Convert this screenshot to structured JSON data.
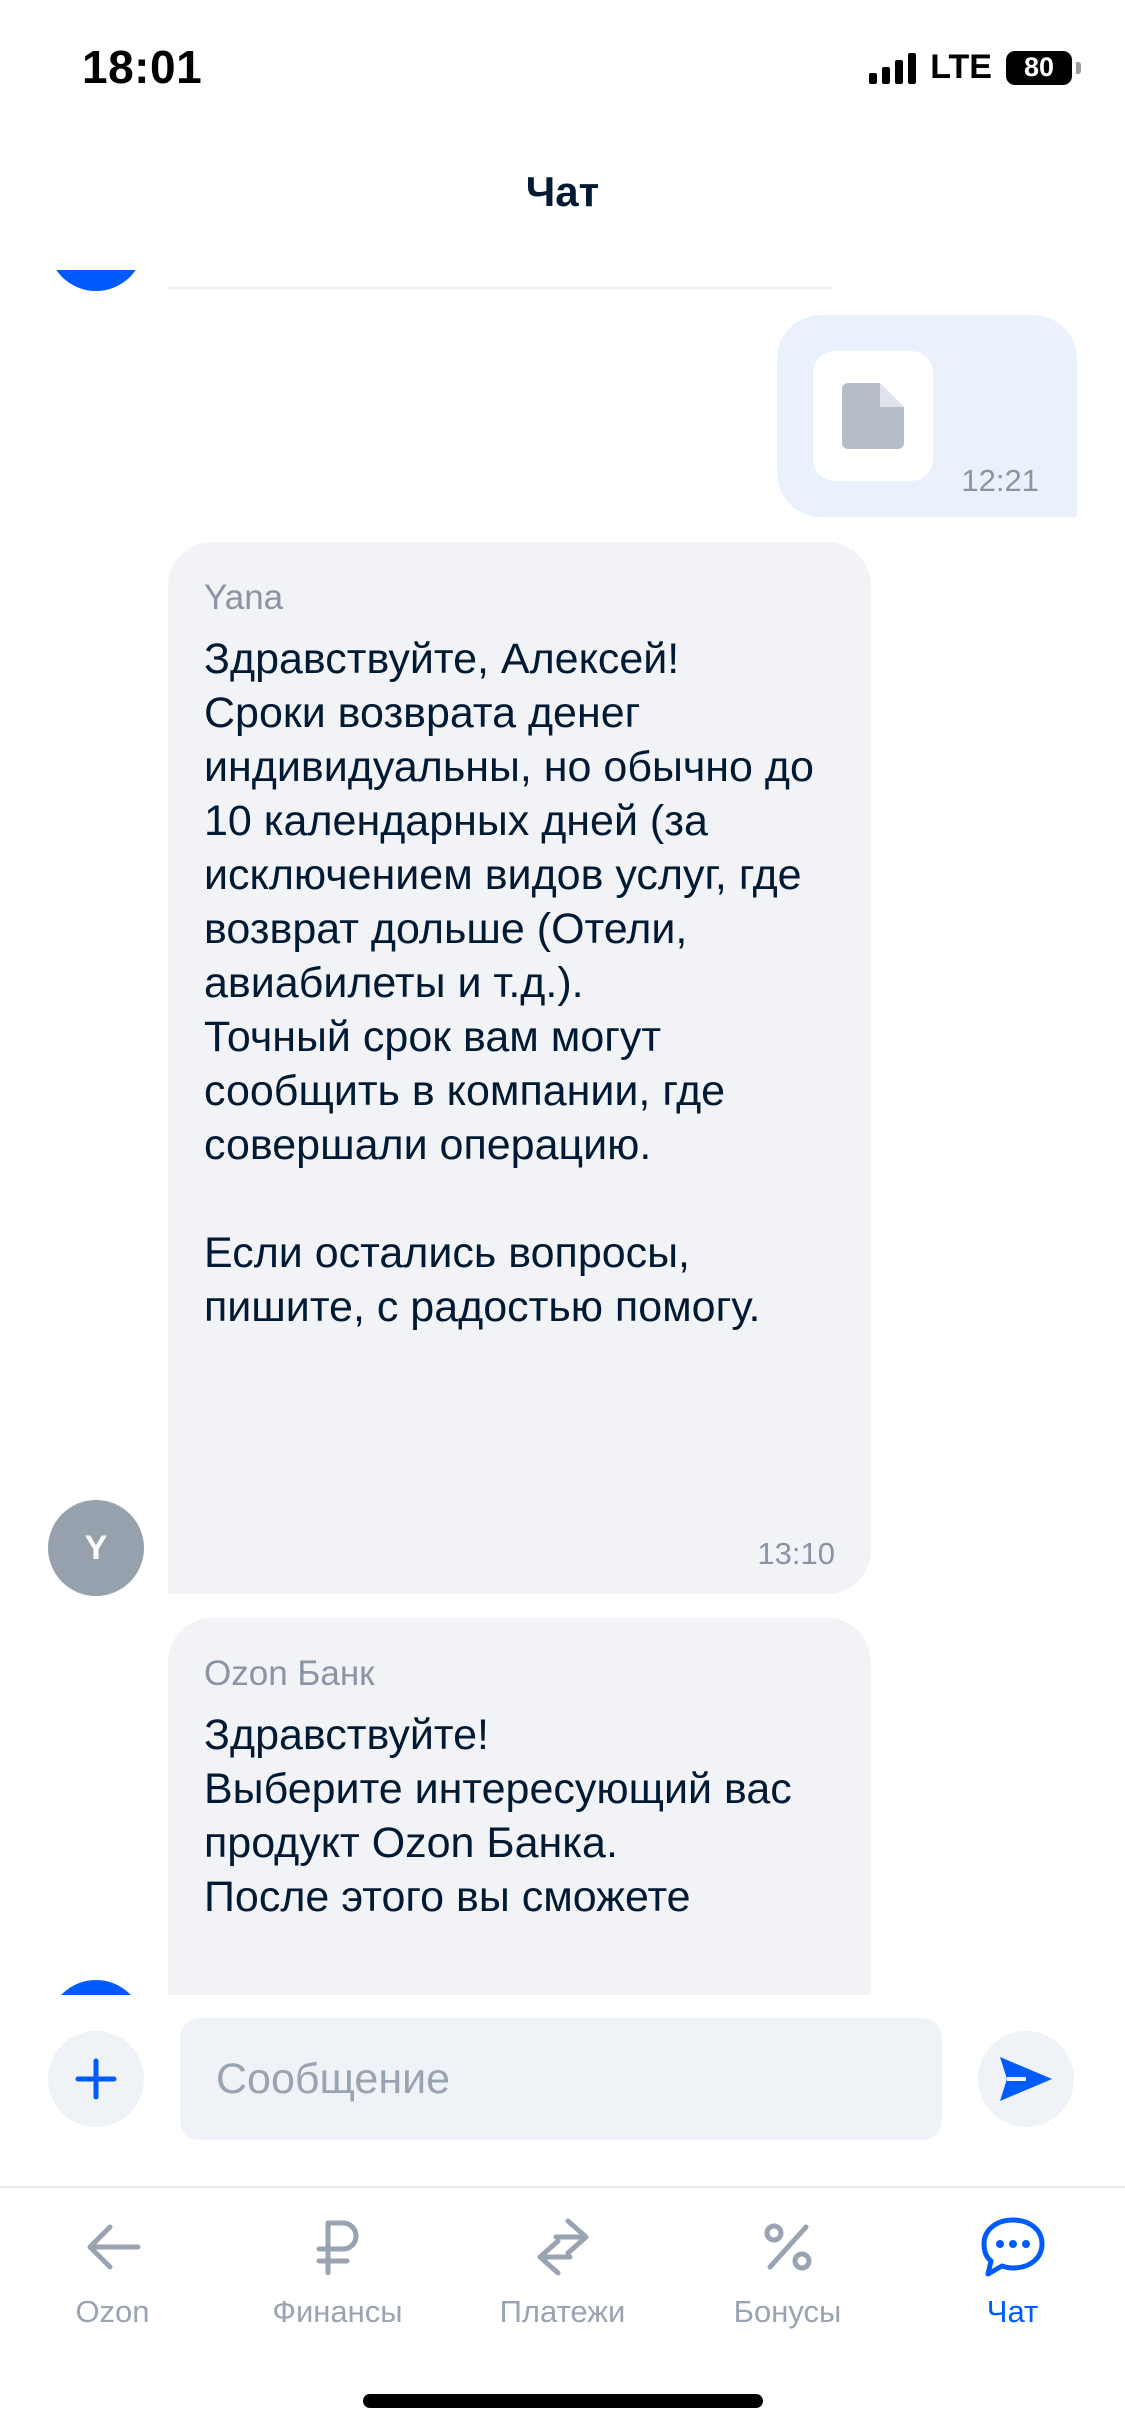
{
  "status_bar": {
    "time": "18:01",
    "network": "LTE",
    "battery": "80"
  },
  "header": {
    "title": "Чат"
  },
  "file_message": {
    "time": "12:21",
    "icon": "document-icon"
  },
  "messages": [
    {
      "sender": "Yana",
      "text": "Здравствуйте, Алексей!\nСроки возврата денег индивидуальны, но обычно до 10 календарных дней (за исключением видов услуг, где возврат дольше (Отели, авиабилеты и т.д.).\nТочный срок вам могут сообщить в компании, где совершали операцию.\n\nЕсли остались вопросы, пишите, с радостью помогу.",
      "time": "13:10",
      "avatar_letter": "Y"
    },
    {
      "sender": "Ozon Банк",
      "text": "Здравствуйте!\nВыберите интересующий вас продукт Ozon Банка.\nПосле этого вы сможете",
      "time": ""
    }
  ],
  "input": {
    "placeholder": "Сообщение",
    "value": ""
  },
  "nav": {
    "items": [
      {
        "label": "Ozon",
        "icon": "arrow-left-icon",
        "active": false
      },
      {
        "label": "Финансы",
        "icon": "ruble-icon",
        "active": false
      },
      {
        "label": "Платежи",
        "icon": "transfer-arrows-icon",
        "active": false
      },
      {
        "label": "Бонусы",
        "icon": "percent-icon",
        "active": false
      },
      {
        "label": "Чат",
        "icon": "chat-bubble-icon",
        "active": true
      }
    ]
  },
  "colors": {
    "accent": "#005bff",
    "text_primary": "#001a34",
    "text_secondary": "#8b94a4",
    "bubble_incoming": "#f1f3f7",
    "bubble_outgoing": "#eaf1fd",
    "input_bg": "#eff2f6",
    "avatar_gray": "#97a0ad"
  }
}
